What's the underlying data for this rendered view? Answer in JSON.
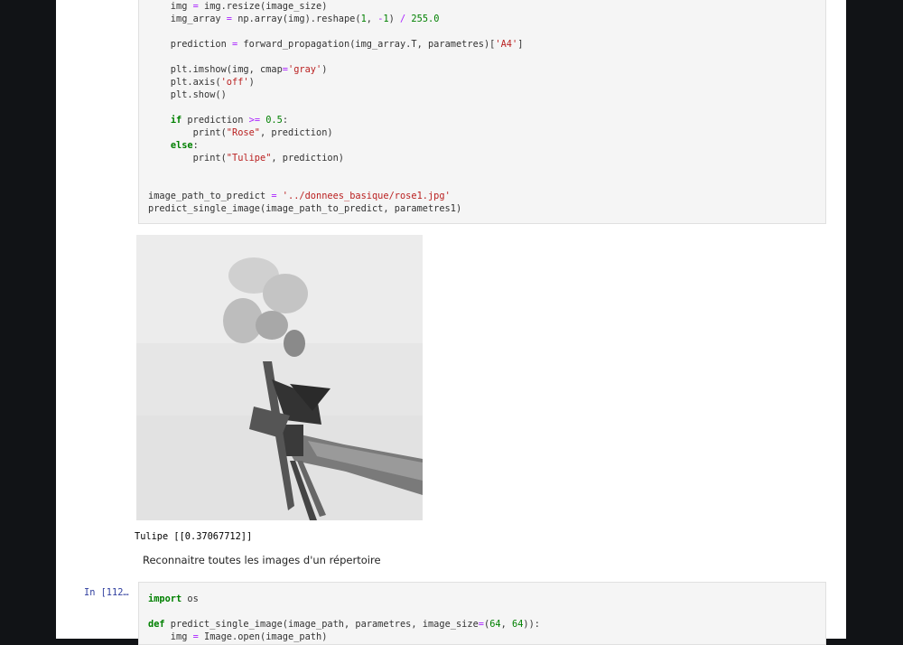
{
  "cell1": {
    "lines": [
      "    img = img.resize(image_size)",
      "    img_array = np.array(img).reshape(1, -1) / 255.0",
      "",
      "    prediction = forward_propagation(img_array.T, parametres)['A4']",
      "",
      "    plt.imshow(img, cmap='gray')",
      "    plt.axis('off')",
      "    plt.show()",
      "",
      "    if prediction >= 0.5:",
      "        print(\"Rose\", prediction)",
      "    else:",
      "        print(\"Tulipe\", prediction)",
      "",
      "",
      "image_path_to_predict = '../donnees_basique/rose1.jpg'",
      "predict_single_image(image_path_to_predict, parametres1)"
    ]
  },
  "output": {
    "image_name": "pixelated-grayscale-roses-in-hand-image",
    "text": "Tulipe [[0.37067712]]"
  },
  "markdown": {
    "text": "Reconnaitre toutes les images d'un répertoire"
  },
  "cell2": {
    "prompt": "In [112…",
    "lines": [
      "import os",
      "",
      "def predict_single_image(image_path, parametres, image_size=(64, 64)):",
      "    img = Image.open(image_path)"
    ]
  }
}
